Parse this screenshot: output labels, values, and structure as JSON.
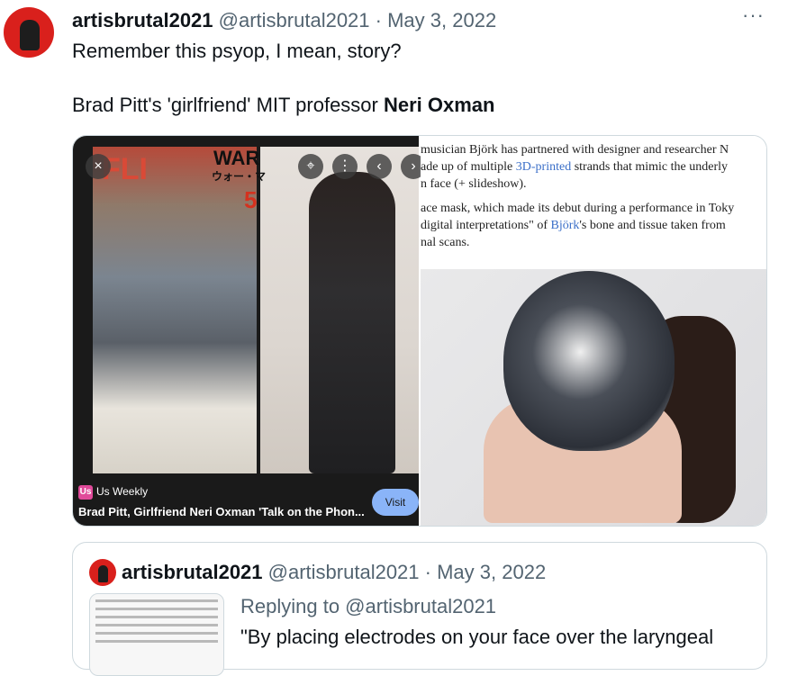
{
  "tweet": {
    "display_name": "artisbrutal2021",
    "handle": "@artisbrutal2021",
    "separator": "·",
    "date": "May 3, 2022",
    "more_label": "···",
    "text_line1": "Remember this psyop, I mean, story?",
    "text_line2_prefix": "Brad Pitt's 'girlfriend' MIT professor ",
    "text_line2_bold": "Neri Oxman"
  },
  "media_left": {
    "source_logo": "Us",
    "source_name": "Us Weekly",
    "headline": "Brad Pitt, Girlfriend Neri Oxman 'Talk on the Phon...",
    "visit_label": "Visit",
    "controls": [
      "×",
      "⌖",
      "⋮",
      "‹",
      "›"
    ],
    "background_sign_1": "WAR",
    "background_sign_2": "ウォー・マ",
    "background_sign_3": "5",
    "background_sign_4": "FLI"
  },
  "media_right": {
    "para1_line1": "musician Björk has partnered with designer and researcher N",
    "para1_line2_a": "ade up of multiple ",
    "para1_line2_link": "3D-printed",
    "para1_line2_b": " strands that mimic the underly",
    "para1_line3": "n face (+ slideshow).",
    "para2_line1": "ace mask, which made its debut during a performance in Toky",
    "para2_line2_a": " digital interpretations\" of ",
    "para2_line2_link": "Björk",
    "para2_line2_b": "'s bone and tissue taken from",
    "para2_line3": "nal scans."
  },
  "quote": {
    "display_name": "artisbrutal2021",
    "handle": "@artisbrutal2021",
    "separator": "·",
    "date": "May 3, 2022",
    "replying_to": "Replying to @artisbrutal2021",
    "text": "\"By placing electrodes on your face over the laryngeal"
  }
}
